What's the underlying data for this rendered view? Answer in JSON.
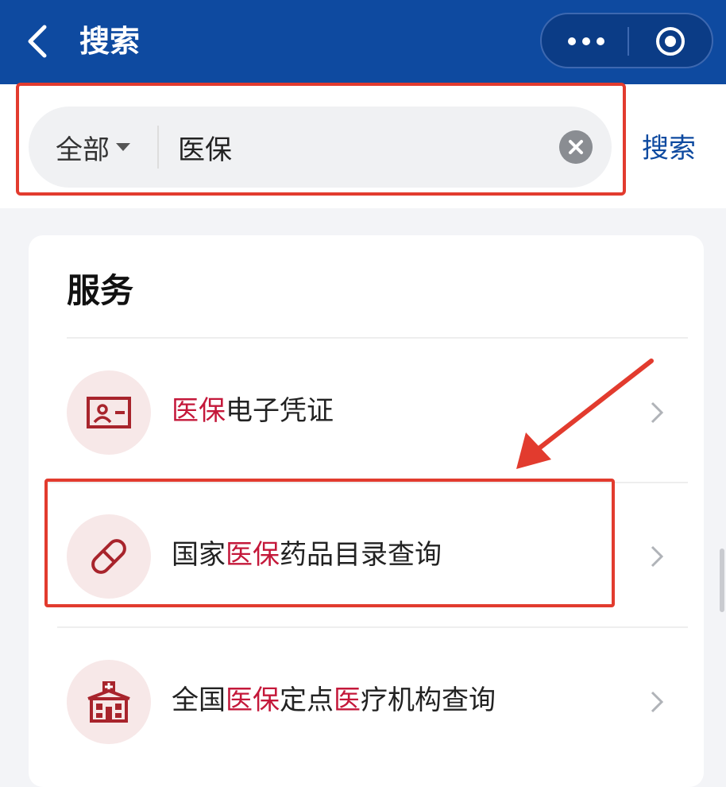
{
  "navbar": {
    "title": "搜索"
  },
  "search": {
    "scope": "全部",
    "value": "医保",
    "button_label": "搜索"
  },
  "services": {
    "title": "服务",
    "items": [
      {
        "icon": "id-card-icon",
        "segments": [
          {
            "text": "医保",
            "highlight": true
          },
          {
            "text": "电子凭证",
            "highlight": false
          }
        ]
      },
      {
        "icon": "pill-icon",
        "segments": [
          {
            "text": "国家",
            "highlight": false
          },
          {
            "text": "医保",
            "highlight": true
          },
          {
            "text": "药品目录查询",
            "highlight": false
          }
        ]
      },
      {
        "icon": "hospital-icon",
        "segments": [
          {
            "text": "全国",
            "highlight": false
          },
          {
            "text": "医保",
            "highlight": true
          },
          {
            "text": "定点",
            "highlight": false
          },
          {
            "text": "医",
            "highlight": true
          },
          {
            "text": "疗机构查询",
            "highlight": false
          }
        ]
      }
    ]
  },
  "colors": {
    "navbar": "#0e4aa0",
    "keyword_highlight": "#c4183a",
    "annotation": "#e23b2e",
    "icon": "#a8242c"
  }
}
